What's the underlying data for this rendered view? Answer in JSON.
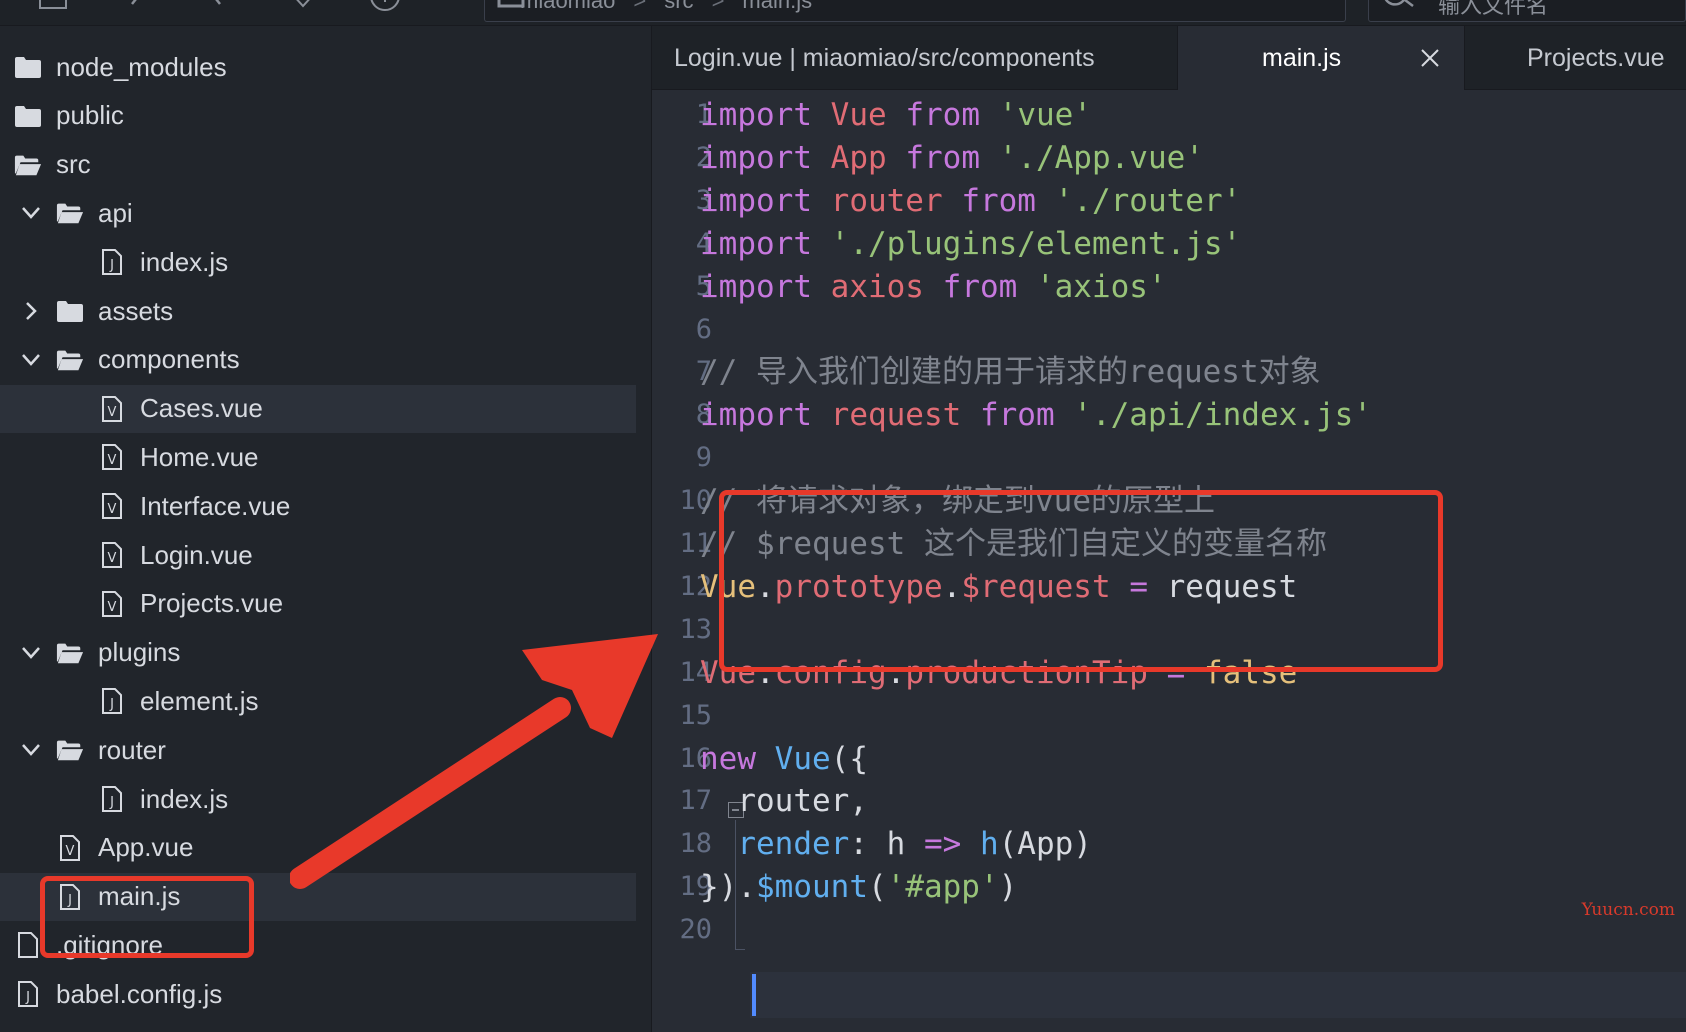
{
  "toolbar": {
    "breadcrumb": [
      "miaomiao",
      "src",
      "main.js"
    ],
    "search_placeholder": "输入文件名"
  },
  "sidebar": {
    "items": [
      {
        "label": "node_modules",
        "type": "folder",
        "depth": 0,
        "expanded": false,
        "chevron": false
      },
      {
        "label": "public",
        "type": "folder",
        "depth": 0,
        "expanded": false,
        "chevron": false
      },
      {
        "label": "src",
        "type": "folder-open",
        "depth": 0,
        "expanded": true,
        "chevron": false
      },
      {
        "label": "api",
        "type": "folder-open",
        "depth": 1,
        "expanded": true,
        "chevron": true
      },
      {
        "label": "index.js",
        "type": "js",
        "depth": 2
      },
      {
        "label": "assets",
        "type": "folder",
        "depth": 1,
        "expanded": false,
        "chevron": true
      },
      {
        "label": "components",
        "type": "folder-open",
        "depth": 1,
        "expanded": true,
        "chevron": true
      },
      {
        "label": "Cases.vue",
        "type": "vue",
        "depth": 2,
        "selected": true
      },
      {
        "label": "Home.vue",
        "type": "vue",
        "depth": 2
      },
      {
        "label": "Interface.vue",
        "type": "vue",
        "depth": 2
      },
      {
        "label": "Login.vue",
        "type": "vue",
        "depth": 2
      },
      {
        "label": "Projects.vue",
        "type": "vue",
        "depth": 2
      },
      {
        "label": "plugins",
        "type": "folder-open",
        "depth": 1,
        "expanded": true,
        "chevron": true
      },
      {
        "label": "element.js",
        "type": "js",
        "depth": 2
      },
      {
        "label": "router",
        "type": "folder-open",
        "depth": 1,
        "expanded": true,
        "chevron": true
      },
      {
        "label": "index.js",
        "type": "js",
        "depth": 2
      },
      {
        "label": "App.vue",
        "type": "vue",
        "depth": 1
      },
      {
        "label": "main.js",
        "type": "js",
        "depth": 1,
        "selected": true
      },
      {
        "label": ".gitignore",
        "type": "file",
        "depth": 0
      },
      {
        "label": "babel.config.js",
        "type": "js",
        "depth": 0
      }
    ]
  },
  "tabs": [
    {
      "label": "Login.vue | miaomiao/src/components",
      "active": false
    },
    {
      "label": "main.js",
      "active": true
    },
    {
      "label": "Projects.vue",
      "active": false
    }
  ],
  "editor": {
    "lines": [
      [
        [
          "kw",
          "import"
        ],
        [
          "pl",
          " "
        ],
        [
          "id",
          "Vue"
        ],
        [
          "pl",
          " "
        ],
        [
          "kw",
          "from"
        ],
        [
          "pl",
          " "
        ],
        [
          "str",
          "'vue'"
        ]
      ],
      [
        [
          "kw",
          "import"
        ],
        [
          "pl",
          " "
        ],
        [
          "id",
          "App"
        ],
        [
          "pl",
          " "
        ],
        [
          "kw",
          "from"
        ],
        [
          "pl",
          " "
        ],
        [
          "str",
          "'./App.vue'"
        ]
      ],
      [
        [
          "kw",
          "import"
        ],
        [
          "pl",
          " "
        ],
        [
          "id",
          "router"
        ],
        [
          "pl",
          " "
        ],
        [
          "kw",
          "from"
        ],
        [
          "pl",
          " "
        ],
        [
          "str",
          "'./router'"
        ]
      ],
      [
        [
          "kw",
          "import"
        ],
        [
          "pl",
          " "
        ],
        [
          "str",
          "'./plugins/element.js'"
        ]
      ],
      [
        [
          "kw",
          "import"
        ],
        [
          "pl",
          " "
        ],
        [
          "id",
          "axios"
        ],
        [
          "pl",
          " "
        ],
        [
          "kw",
          "from"
        ],
        [
          "pl",
          " "
        ],
        [
          "str",
          "'axios'"
        ]
      ],
      [],
      [
        [
          "cm",
          "// 导入我们创建的用于请求的request对象"
        ]
      ],
      [
        [
          "kw",
          "import"
        ],
        [
          "pl",
          " "
        ],
        [
          "id",
          "request"
        ],
        [
          "pl",
          " "
        ],
        [
          "kw",
          "from"
        ],
        [
          "pl",
          " "
        ],
        [
          "str",
          "'./api/index.js'"
        ]
      ],
      [],
      [
        [
          "cm",
          "// 将请求对象，绑定到vue的原型上"
        ]
      ],
      [
        [
          "cm",
          "// $request 这个是我们自定义的变量名称"
        ]
      ],
      [
        [
          "cls",
          "Vue"
        ],
        [
          "pl",
          "."
        ],
        [
          "id",
          "prototype"
        ],
        [
          "pl",
          "."
        ],
        [
          "id",
          "$request"
        ],
        [
          "pl",
          " "
        ],
        [
          "op",
          "="
        ],
        [
          "pl",
          " request"
        ]
      ],
      [],
      [
        [
          "id",
          "Vue"
        ],
        [
          "pl",
          "."
        ],
        [
          "id",
          "config"
        ],
        [
          "pl",
          "."
        ],
        [
          "id",
          "productionTip"
        ],
        [
          "pl",
          " "
        ],
        [
          "op",
          "="
        ],
        [
          "pl",
          " "
        ],
        [
          "bool",
          "false"
        ]
      ],
      [],
      [
        [
          "kw",
          "new"
        ],
        [
          "pl",
          " "
        ],
        [
          "fn",
          "Vue"
        ],
        [
          "pl",
          "({"
        ]
      ],
      [
        [
          "pl",
          "  router,"
        ]
      ],
      [
        [
          "pl",
          "  "
        ],
        [
          "fn",
          "render"
        ],
        [
          "pl",
          ": h "
        ],
        [
          "op",
          "=>"
        ],
        [
          "pl",
          " "
        ],
        [
          "fn",
          "h"
        ],
        [
          "pl",
          "(App)"
        ]
      ],
      [
        [
          "pl",
          "})."
        ],
        [
          "fn",
          "$mount"
        ],
        [
          "pl",
          "("
        ],
        [
          "str",
          "'#app'"
        ],
        [
          "pl",
          ")"
        ]
      ],
      []
    ]
  },
  "watermark": "Yuucn.com",
  "colors": {
    "annotation_red": "#e8392a",
    "cursor_blue": "#528bff"
  }
}
